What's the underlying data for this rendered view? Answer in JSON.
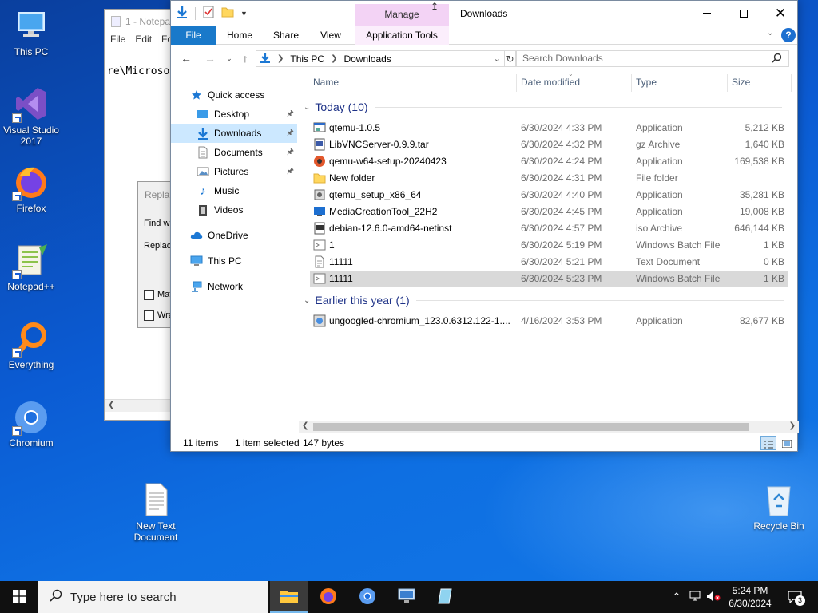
{
  "desktop": {
    "icons": [
      {
        "label": "This PC"
      },
      {
        "label": "Visual Studio 2017"
      },
      {
        "label": "Firefox"
      },
      {
        "label": "Notepad++"
      },
      {
        "label": "Everything"
      },
      {
        "label": "Chromium"
      },
      {
        "label": "New Text Document"
      },
      {
        "label": "Recycle Bin"
      }
    ]
  },
  "notepad": {
    "title": "1 - Notepa",
    "menu": [
      "File",
      "Edit",
      "Fo"
    ],
    "content": "re\\Microso"
  },
  "replace_dialog": {
    "title": "Repla",
    "find_label": "Find wh",
    "replace_label": "Replac",
    "match_label": "Mat",
    "wrap_label": "Wra"
  },
  "explorer": {
    "manage_tab": "Manage",
    "title": "Downloads",
    "ribbon_tabs": {
      "file": "File",
      "home": "Home",
      "share": "Share",
      "view": "View",
      "app_tools": "Application Tools"
    },
    "address": {
      "segments": [
        "This PC",
        "Downloads"
      ]
    },
    "search": {
      "placeholder": "Search Downloads"
    },
    "nav": {
      "quick_access": "Quick access",
      "desktop": "Desktop",
      "downloads": "Downloads",
      "documents": "Documents",
      "pictures": "Pictures",
      "music": "Music",
      "videos": "Videos",
      "onedrive": "OneDrive",
      "thispc": "This PC",
      "network": "Network"
    },
    "columns": {
      "name": "Name",
      "date": "Date modified",
      "type": "Type",
      "size": "Size"
    },
    "groups": {
      "today": "Today (10)",
      "earlier": "Earlier this year (1)"
    },
    "files": [
      {
        "name": "qtemu-1.0.5",
        "date": "6/30/2024 4:33 PM",
        "type": "Application",
        "size": "5,212 KB"
      },
      {
        "name": "LibVNCServer-0.9.9.tar",
        "date": "6/30/2024 4:32 PM",
        "type": "gz Archive",
        "size": "1,640 KB"
      },
      {
        "name": "qemu-w64-setup-20240423",
        "date": "6/30/2024 4:24 PM",
        "type": "Application",
        "size": "169,538 KB"
      },
      {
        "name": "New folder",
        "date": "6/30/2024 4:31 PM",
        "type": "File folder",
        "size": ""
      },
      {
        "name": "qtemu_setup_x86_64",
        "date": "6/30/2024 4:40 PM",
        "type": "Application",
        "size": "35,281 KB"
      },
      {
        "name": "MediaCreationTool_22H2",
        "date": "6/30/2024 4:45 PM",
        "type": "Application",
        "size": "19,008 KB"
      },
      {
        "name": "debian-12.6.0-amd64-netinst",
        "date": "6/30/2024 4:57 PM",
        "type": "iso Archive",
        "size": "646,144 KB"
      },
      {
        "name": "1",
        "date": "6/30/2024 5:19 PM",
        "type": "Windows Batch File",
        "size": "1 KB"
      },
      {
        "name": "11111",
        "date": "6/30/2024 5:21 PM",
        "type": "Text Document",
        "size": "0 KB"
      },
      {
        "name": "11111",
        "date": "6/30/2024 5:23 PM",
        "type": "Windows Batch File",
        "size": "1 KB"
      },
      {
        "name": "ungoogled-chromium_123.0.6312.122-1....",
        "date": "4/16/2024 3:53 PM",
        "type": "Application",
        "size": "82,677 KB"
      }
    ],
    "status": {
      "items": "11 items",
      "selected": "1 item selected",
      "bytes": "147 bytes"
    }
  },
  "taskbar": {
    "search_placeholder": "Type here to search",
    "clock_time": "5:24 PM",
    "clock_date": "6/30/2024",
    "notification_count": "3"
  },
  "colors": {
    "accent": "#1979ca",
    "selection": "#cce8ff",
    "manage": "#f3d3f5"
  }
}
